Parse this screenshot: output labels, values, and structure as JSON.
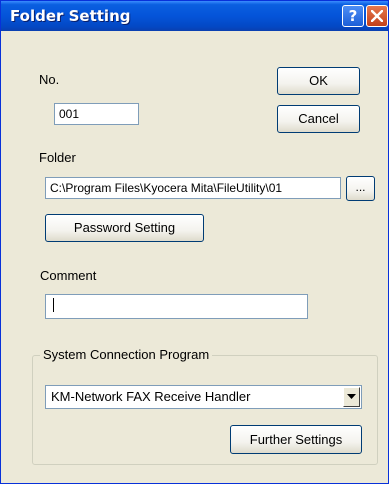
{
  "window": {
    "title": "Folder Setting",
    "help_glyph": "?",
    "close_icon": "close-x-icon"
  },
  "no": {
    "label": "No.",
    "value": "001"
  },
  "buttons": {
    "ok": "OK",
    "cancel": "Cancel",
    "browse": "...",
    "password": "Password Setting",
    "further": "Further Settings"
  },
  "folder": {
    "label": "Folder",
    "value": "C:\\Program Files\\Kyocera Mita\\FileUtility\\01"
  },
  "comment": {
    "label": "Comment",
    "value": ""
  },
  "system_connection": {
    "group_label": "System Connection Program",
    "selected": "KM-Network FAX Receive Handler"
  },
  "colors": {
    "titlebar": "#0454d9",
    "dialog_bg": "#ece9d8",
    "close_button": "#c2401a",
    "button_border": "#003c74"
  }
}
